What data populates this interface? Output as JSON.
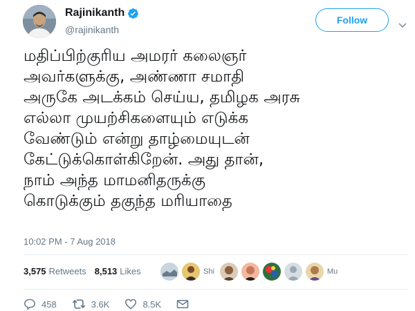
{
  "author": {
    "display_name": "Rajinikanth",
    "handle": "@rajinikanth",
    "verified": true
  },
  "follow_label": "Follow",
  "colors": {
    "accent": "#1da1f2",
    "text": "#14171a",
    "muted": "#657786",
    "divider": "#e6ecf0"
  },
  "tweet": {
    "lines": [
      "மதிப்பிற்குரிய அமரர் கலைஞர்",
      "அவர்களுக்கு, அண்ணா சமாதி",
      "அருகே அடக்கம் செய்ய, தமிழக அரசு",
      "எல்லா முயற்சிகளையும் எடுக்க",
      "வேண்டும் என்று தாழ்மையுடன்",
      "கேட்டுக்கொள்கிறேன். அது தான்,",
      "நாம் அந்த மாமனிதருக்கு",
      "கொடுக்கும் தகுந்த மரியாதை"
    ],
    "timestamp": "10:02 PM - 7 Aug 2018"
  },
  "stats": {
    "retweets_count": "3,575",
    "retweets_label": "Retweets",
    "likes_count": "8,513",
    "likes_label": "Likes"
  },
  "likers": {
    "name_fragments": [
      "Shi",
      "Mu"
    ]
  },
  "actions": {
    "replies": "458",
    "retweets": "3.6K",
    "likes": "8.5K"
  },
  "icons": [
    "verified-badge-icon",
    "chevron-down-icon",
    "reply-icon",
    "retweet-icon",
    "like-heart-icon",
    "dm-envelope-icon"
  ]
}
